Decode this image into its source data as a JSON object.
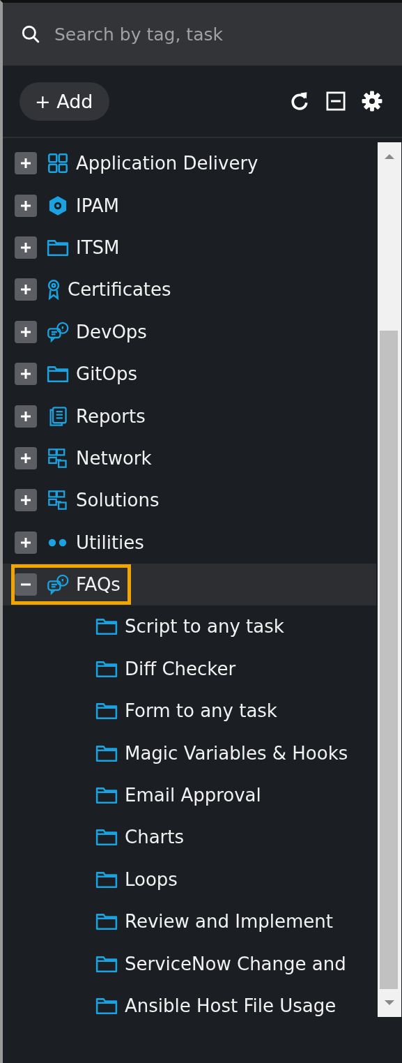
{
  "search": {
    "placeholder": "Search by tag, task"
  },
  "toolbar": {
    "add_button": "+ Add"
  },
  "tree": [
    {
      "label": "Application Delivery",
      "kind": "grid",
      "expanded": false,
      "selected": false
    },
    {
      "label": "IPAM",
      "kind": "hexagon",
      "expanded": false,
      "selected": false
    },
    {
      "label": "ITSM",
      "kind": "folder",
      "expanded": false,
      "selected": false
    },
    {
      "label": "Certificates",
      "kind": "badge",
      "expanded": false,
      "selected": false
    },
    {
      "label": "DevOps",
      "kind": "chat",
      "expanded": false,
      "selected": false
    },
    {
      "label": "GitOps",
      "kind": "folder",
      "expanded": false,
      "selected": false
    },
    {
      "label": "Reports",
      "kind": "document",
      "expanded": false,
      "selected": false
    },
    {
      "label": "Network",
      "kind": "network",
      "expanded": false,
      "selected": false
    },
    {
      "label": "Solutions",
      "kind": "network",
      "expanded": false,
      "selected": false
    },
    {
      "label": "Utilities",
      "kind": "dots",
      "expanded": false,
      "selected": false
    },
    {
      "label": "FAQs",
      "kind": "chat",
      "expanded": true,
      "selected": true,
      "children": [
        {
          "label": "Script to any task",
          "kind": "folder",
          "selected": false
        },
        {
          "label": "Diff Checker",
          "kind": "folder",
          "selected": false
        },
        {
          "label": "Form to any task",
          "kind": "folder",
          "selected": false
        },
        {
          "label": "Magic Variables & Hooks",
          "kind": "folder",
          "selected": false
        },
        {
          "label": "Email Approval",
          "kind": "folder",
          "selected": false
        },
        {
          "label": "Charts",
          "kind": "folder",
          "selected": false
        },
        {
          "label": "Loops",
          "kind": "folder",
          "selected": false
        },
        {
          "label": "Review and Implement",
          "kind": "folder",
          "selected": false
        },
        {
          "label": "ServiceNow Change and",
          "kind": "folder",
          "selected": false
        },
        {
          "label": "Ansible Host File Usage",
          "kind": "folder",
          "selected": false
        }
      ]
    }
  ]
}
